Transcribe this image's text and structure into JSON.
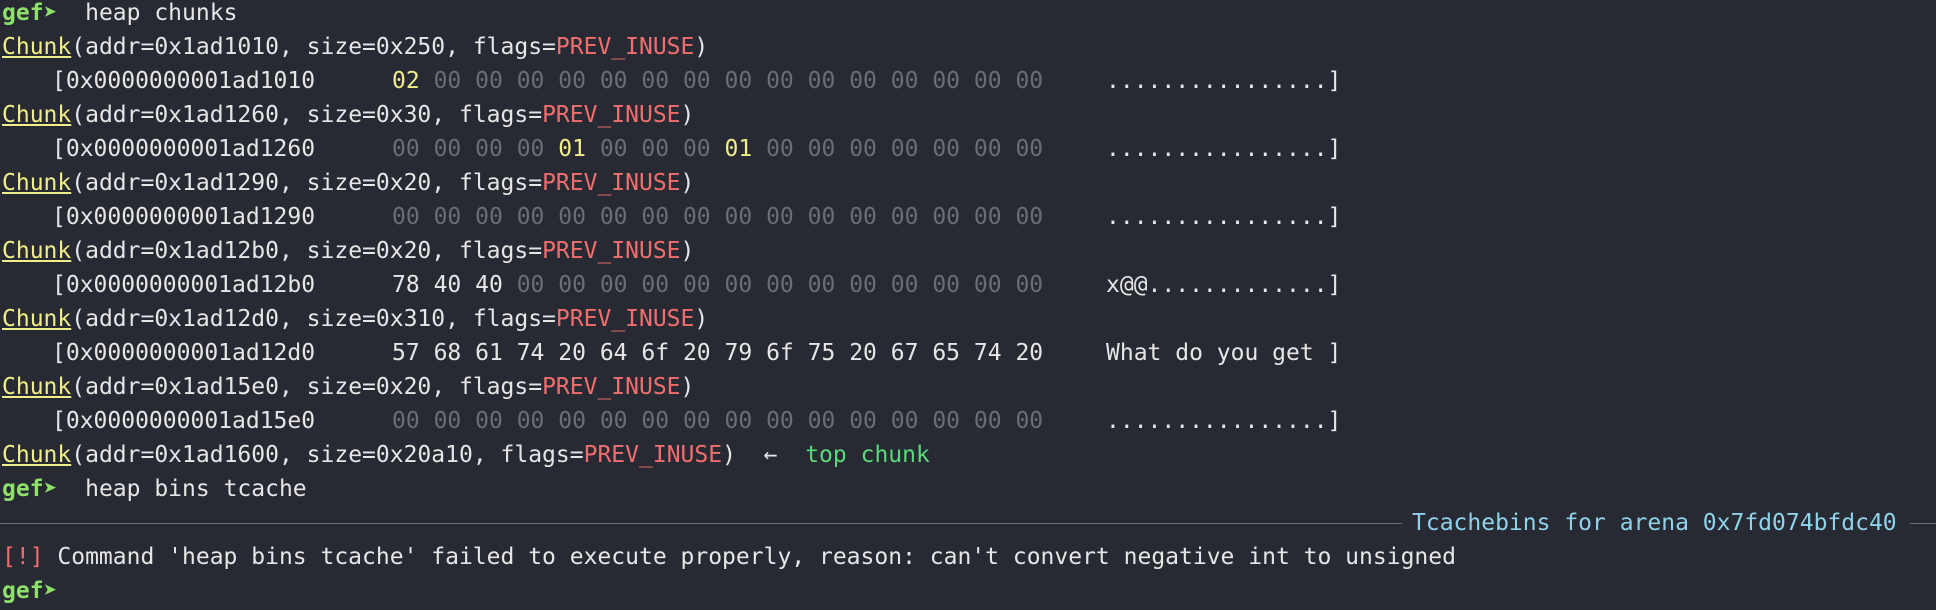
{
  "prompt": "gef➤",
  "cmd1": "heap chunks",
  "chunk_label": "Chunk",
  "flags_value": "PREV_INUSE",
  "chunks": [
    {
      "header": "(addr=0x1ad1010, size=0x250, flags=",
      "addr": "[0x0000000001ad1010",
      "bytes": [
        "02",
        "00",
        "00",
        "00",
        "00",
        "00",
        "00",
        "00",
        "00",
        "00",
        "00",
        "00",
        "00",
        "00",
        "00",
        "00"
      ],
      "ascii": "................]"
    },
    {
      "header": "(addr=0x1ad1260, size=0x30, flags=",
      "addr": "[0x0000000001ad1260",
      "bytes": [
        "00",
        "00",
        "00",
        "00",
        "01",
        "00",
        "00",
        "00",
        "01",
        "00",
        "00",
        "00",
        "00",
        "00",
        "00",
        "00"
      ],
      "ascii": "................]"
    },
    {
      "header": "(addr=0x1ad1290, size=0x20, flags=",
      "addr": "[0x0000000001ad1290",
      "bytes": [
        "00",
        "00",
        "00",
        "00",
        "00",
        "00",
        "00",
        "00",
        "00",
        "00",
        "00",
        "00",
        "00",
        "00",
        "00",
        "00"
      ],
      "ascii": "................]"
    },
    {
      "header": "(addr=0x1ad12b0, size=0x20, flags=",
      "addr": "[0x0000000001ad12b0",
      "bytes": [
        "78",
        "40",
        "40",
        "00",
        "00",
        "00",
        "00",
        "00",
        "00",
        "00",
        "00",
        "00",
        "00",
        "00",
        "00",
        "00"
      ],
      "ascii": "x@@.............]"
    },
    {
      "header": "(addr=0x1ad12d0, size=0x310, flags=",
      "addr": "[0x0000000001ad12d0",
      "bytes": [
        "57",
        "68",
        "61",
        "74",
        "20",
        "64",
        "6f",
        "20",
        "79",
        "6f",
        "75",
        "20",
        "67",
        "65",
        "74",
        "20"
      ],
      "ascii": "What do you get ]"
    },
    {
      "header": "(addr=0x1ad15e0, size=0x20, flags=",
      "addr": "[0x0000000001ad15e0",
      "bytes": [
        "00",
        "00",
        "00",
        "00",
        "00",
        "00",
        "00",
        "00",
        "00",
        "00",
        "00",
        "00",
        "00",
        "00",
        "00",
        "00"
      ],
      "ascii": "................]"
    }
  ],
  "top_chunk": {
    "header": "(addr=0x1ad1600, size=0x20a10, flags=",
    "close": ")",
    "arrow": "  ←  ",
    "label": "top chunk"
  },
  "cmd2": "heap bins tcache",
  "section_title": "Tcachebins for arena 0x7fd074bfdc40",
  "error_tag": "[!]",
  "error_msg": " Command 'heap bins tcache' failed to execute properly, reason: can't convert negative int to unsigned",
  "colors": {
    "background": "#282a33",
    "prompt": "#8ee06b",
    "chunk": "#f0ee8a",
    "flag": "#f26e6e",
    "dim": "#6a6d75",
    "title": "#8fd3ea"
  }
}
